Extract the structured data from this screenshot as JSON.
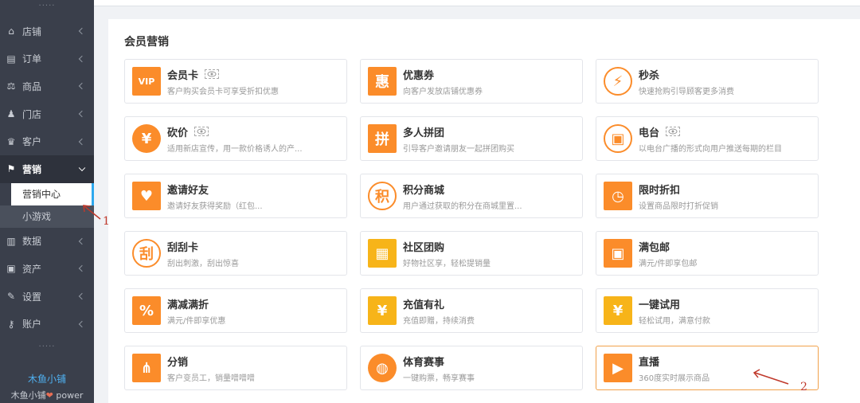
{
  "sidebar": {
    "dots_top": "·····",
    "items": [
      {
        "label": "店铺",
        "icon": "shop-icon"
      },
      {
        "label": "订单",
        "icon": "order-icon"
      },
      {
        "label": "商品",
        "icon": "product-icon"
      },
      {
        "label": "门店",
        "icon": "store-icon"
      },
      {
        "label": "客户",
        "icon": "customer-icon"
      },
      {
        "label": "营销",
        "icon": "marketing-icon",
        "active": true
      },
      {
        "label": "数据",
        "icon": "chart-icon"
      },
      {
        "label": "资产",
        "icon": "asset-icon"
      },
      {
        "label": "设置",
        "icon": "wrench-icon"
      },
      {
        "label": "账户",
        "icon": "key-icon"
      }
    ],
    "sub_items": [
      {
        "label": "营销中心",
        "current": true
      },
      {
        "label": "小游戏"
      }
    ],
    "dots_bottom": "·····",
    "brand": "木鱼小铺",
    "power_prefix": "木鱼小铺",
    "power_heart": "❤",
    "power_suffix": " power"
  },
  "panel": {
    "title": "会员营销",
    "cards": [
      {
        "name": "会员卡",
        "desc": "客户购买会员卡可享受折扣优惠",
        "icon": "vip-card-icon",
        "glyph": "VIP",
        "style": "sq",
        "eye": true
      },
      {
        "name": "优惠券",
        "desc": "向客户发放店铺优惠券",
        "icon": "coupon-icon",
        "glyph": "惠",
        "style": "sq"
      },
      {
        "name": "秒杀",
        "desc": "快速抢购引导顾客更多消费",
        "icon": "lightning-icon",
        "glyph": "⚡",
        "style": "ring"
      },
      {
        "name": "砍价",
        "desc": "适用新店宣传，用一款价格诱人的产...",
        "icon": "bargain-icon",
        "glyph": "¥",
        "style": "ci",
        "eye": true
      },
      {
        "name": "多人拼团",
        "desc": "引导客户邀请朋友一起拼团购买",
        "icon": "group-buy-icon",
        "glyph": "拼",
        "style": "sq"
      },
      {
        "name": "电台",
        "desc": "以电台广播的形式向用户推送每期的栏目",
        "icon": "radio-icon",
        "glyph": "▣",
        "style": "ring",
        "eye": true
      },
      {
        "name": "邀请好友",
        "desc": "邀请好友获得奖励（红包...",
        "icon": "invite-icon",
        "glyph": "♥",
        "style": "sq"
      },
      {
        "name": "积分商城",
        "desc": "用户通过获取的积分在商城里置...",
        "icon": "points-mall-icon",
        "glyph": "积",
        "style": "ring"
      },
      {
        "name": "限时折扣",
        "desc": "设置商品限时打折促销",
        "icon": "clock-icon",
        "glyph": "◷",
        "style": "sq"
      },
      {
        "name": "刮刮卡",
        "desc": "刮出刺激，刮出惊喜",
        "icon": "scratch-card-icon",
        "glyph": "刮",
        "style": "ring"
      },
      {
        "name": "社区团购",
        "desc": "好物社区享，轻松提销量",
        "icon": "community-icon",
        "glyph": "▦",
        "style": "yl"
      },
      {
        "name": "满包邮",
        "desc": "满元/件即享包邮",
        "icon": "free-shipping-icon",
        "glyph": "▣",
        "style": "sq"
      },
      {
        "name": "满减满折",
        "desc": "满元/件即享优惠",
        "icon": "discount-icon",
        "glyph": "%",
        "style": "sq"
      },
      {
        "name": "充值有礼",
        "desc": "充值即赠，持续消费",
        "icon": "recharge-icon",
        "glyph": "¥",
        "style": "yl"
      },
      {
        "name": "一键试用",
        "desc": "轻松试用，满意付款",
        "icon": "trial-icon",
        "glyph": "¥",
        "style": "yl"
      },
      {
        "name": "分销",
        "desc": "客户变员工，销量噌噌噌",
        "icon": "distribution-icon",
        "glyph": "⋔",
        "style": "sq"
      },
      {
        "name": "体育赛事",
        "desc": "一键购票，畅享赛事",
        "icon": "basketball-icon",
        "glyph": "◍",
        "style": "ci"
      },
      {
        "name": "直播",
        "desc": "360度实时展示商品",
        "icon": "live-stream-icon",
        "glyph": "▶",
        "style": "sq",
        "highlight": true
      }
    ]
  },
  "annotations": {
    "one": "1",
    "two": "2"
  }
}
